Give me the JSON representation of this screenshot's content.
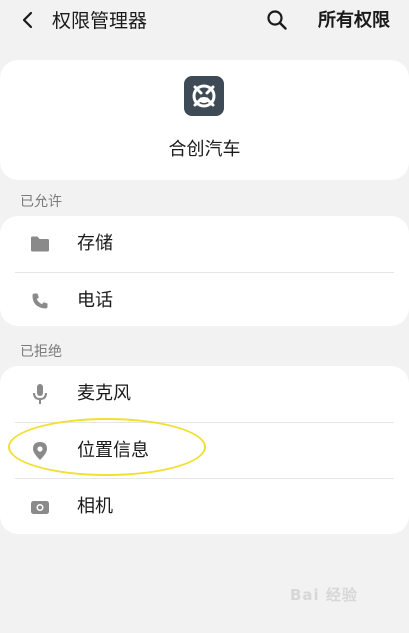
{
  "header": {
    "title": "权限管理器",
    "all_permissions": "所有权限",
    "back_icon": "back-arrow-icon",
    "search_icon": "search-icon"
  },
  "app": {
    "name": "合创汽车",
    "icon_color": "#3e4a56"
  },
  "sections": {
    "allowed": {
      "label": "已允许",
      "items": [
        {
          "label": "存储",
          "icon": "folder-icon"
        },
        {
          "label": "电话",
          "icon": "phone-icon"
        }
      ]
    },
    "denied": {
      "label": "已拒绝",
      "items": [
        {
          "label": "麦克风",
          "icon": "microphone-icon"
        },
        {
          "label": "位置信息",
          "icon": "location-pin-icon"
        },
        {
          "label": "相机",
          "icon": "camera-icon"
        }
      ]
    }
  },
  "annotation": {
    "highlight_color": "#f0e030"
  },
  "watermark": {
    "text": "Bai 经验"
  }
}
